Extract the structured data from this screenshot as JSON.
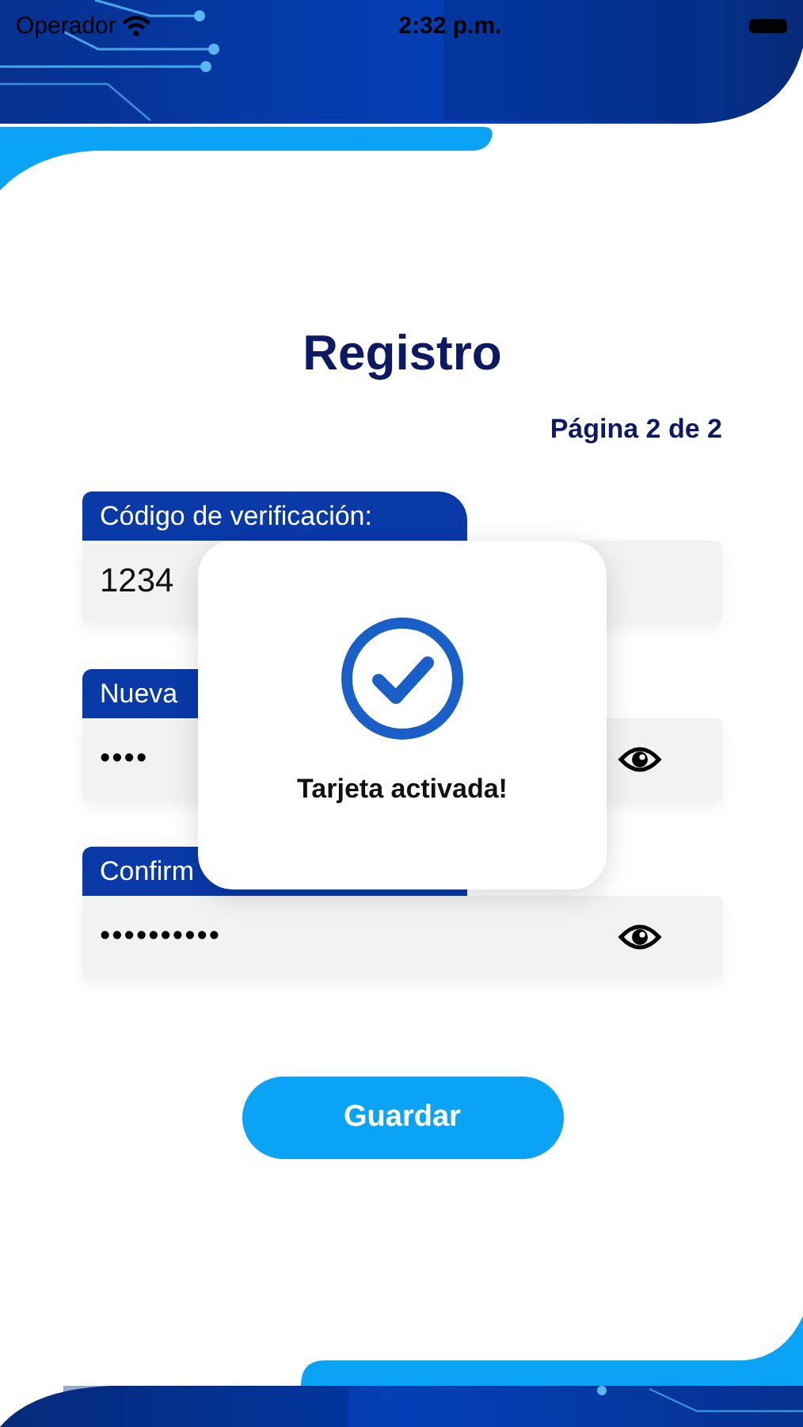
{
  "status_bar": {
    "carrier": "Operador",
    "time": "2:32 p.m."
  },
  "title": "Registro",
  "page_indicator": "Página 2 de 2",
  "fields": [
    {
      "label": "Código de verificación:",
      "value": "1234",
      "kind": "text"
    },
    {
      "label": "Nueva",
      "value": "••••",
      "kind": "password"
    },
    {
      "label": "Confirm",
      "value": "••••••••••",
      "kind": "password"
    }
  ],
  "button": "Guardar",
  "popup": {
    "message": "Tarjeta activada!"
  }
}
